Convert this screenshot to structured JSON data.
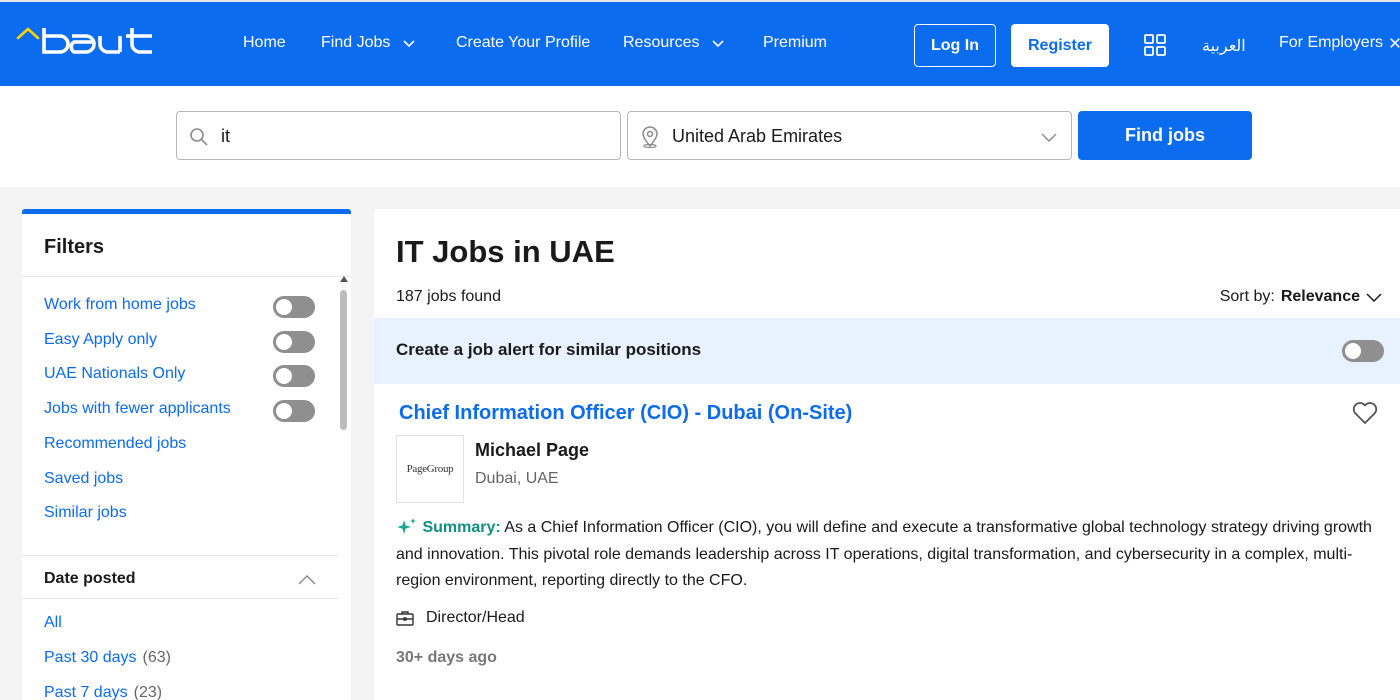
{
  "brand": {
    "logo_text": "bayt",
    "primary_color": "#0b6cf0",
    "header_bg": "#0b6cf0"
  },
  "header": {
    "nav": [
      {
        "label": "Home",
        "dropdown": false
      },
      {
        "label": "Find Jobs",
        "dropdown": true
      },
      {
        "label": "Create Your Profile",
        "dropdown": false
      },
      {
        "label": "Resources",
        "dropdown": true
      },
      {
        "label": "Premium",
        "dropdown": false
      }
    ],
    "login_label": "Log In",
    "register_label": "Register",
    "apps_icon": "grid-icon",
    "language_label": "العربية",
    "employers_label": "For Employers"
  },
  "search": {
    "query": "it",
    "search_icon": "search-icon",
    "location": "United Arab Emirates",
    "location_icon": "map-pin-icon",
    "button_label": "Find jobs"
  },
  "filters": {
    "title": "Filters",
    "toggles": [
      {
        "label": "Work from home jobs",
        "on": false
      },
      {
        "label": "Easy Apply only",
        "on": false
      },
      {
        "label": "UAE Nationals Only",
        "on": false
      },
      {
        "label": "Jobs with fewer applicants",
        "on": false
      }
    ],
    "links": [
      "Recommended jobs",
      "Saved jobs",
      "Similar jobs"
    ],
    "date_posted": {
      "title": "Date posted",
      "options": [
        {
          "label": "All",
          "count": ""
        },
        {
          "label": "Past 30 days",
          "count": "(63)"
        },
        {
          "label": "Past 7 days",
          "count": "(23)"
        }
      ]
    }
  },
  "results": {
    "title": "IT Jobs in UAE",
    "count_text": "187 jobs found",
    "sort_label": "Sort by:",
    "sort_value": "Relevance",
    "alert_text": "Create a job alert for similar positions",
    "alert_on": false,
    "jobs": [
      {
        "title": "Chief Information Officer (CIO) - Dubai (On-Site)",
        "company": "Michael Page",
        "company_logo_text": "PageGroup",
        "location": "Dubai, UAE",
        "summary_label": "Summary:",
        "summary": "As a Chief Information Officer (CIO), you will define and execute a transformative global technology strategy driving growth and innovation. This pivotal role demands leadership across IT operations, digital transformation, and cybersecurity in a complex, multi-region environment, reporting directly to the CFO.",
        "career_level": "Director/Head",
        "posted": "30+ days ago"
      }
    ]
  }
}
